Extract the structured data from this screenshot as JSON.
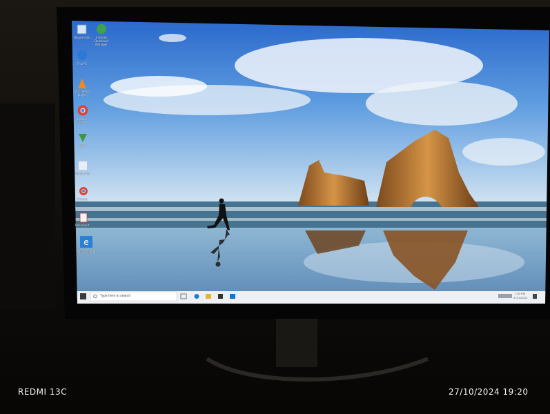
{
  "photo": {
    "subject": "photograph of a computer monitor showing the Windows 10 desktop with a beach wallpaper",
    "colors": {
      "sky_top": "#2f6fd0",
      "sky_bottom": "#cfe3f3",
      "sea": "#3f6f8f",
      "rock": "#c8843a",
      "bezel": "#060606",
      "room": "#14110e"
    }
  },
  "desktop": {
    "icons": [
      {
        "name": "recycle-bin-icon",
        "label": "Recycle Bin"
      },
      {
        "name": "internet-download-manager-icon",
        "label": "Internet Download Manager"
      },
      {
        "name": "this-pc-icon",
        "label": "This PC"
      },
      {
        "name": "vlc-media-player-icon",
        "label": "VLC media player"
      },
      {
        "name": "google-chrome-icon",
        "label": "Google Chrome"
      },
      {
        "name": "vpn-app-icon",
        "label": "VPN"
      },
      {
        "name": "google-file-icon",
        "label": "Google file"
      },
      {
        "name": "chrome-shortcut-icon",
        "label": "Chrome"
      },
      {
        "name": "document-icon",
        "label": "Document"
      },
      {
        "name": "microsoft-edge-icon",
        "label": "Microsoft Edge"
      }
    ]
  },
  "taskbar": {
    "search_placeholder": "Type here to search",
    "time": "7:20 PM",
    "date": "27/10/2024"
  },
  "watermark": {
    "device": "REDMI 13C",
    "timestamp": "27/10/2024  19:20"
  }
}
